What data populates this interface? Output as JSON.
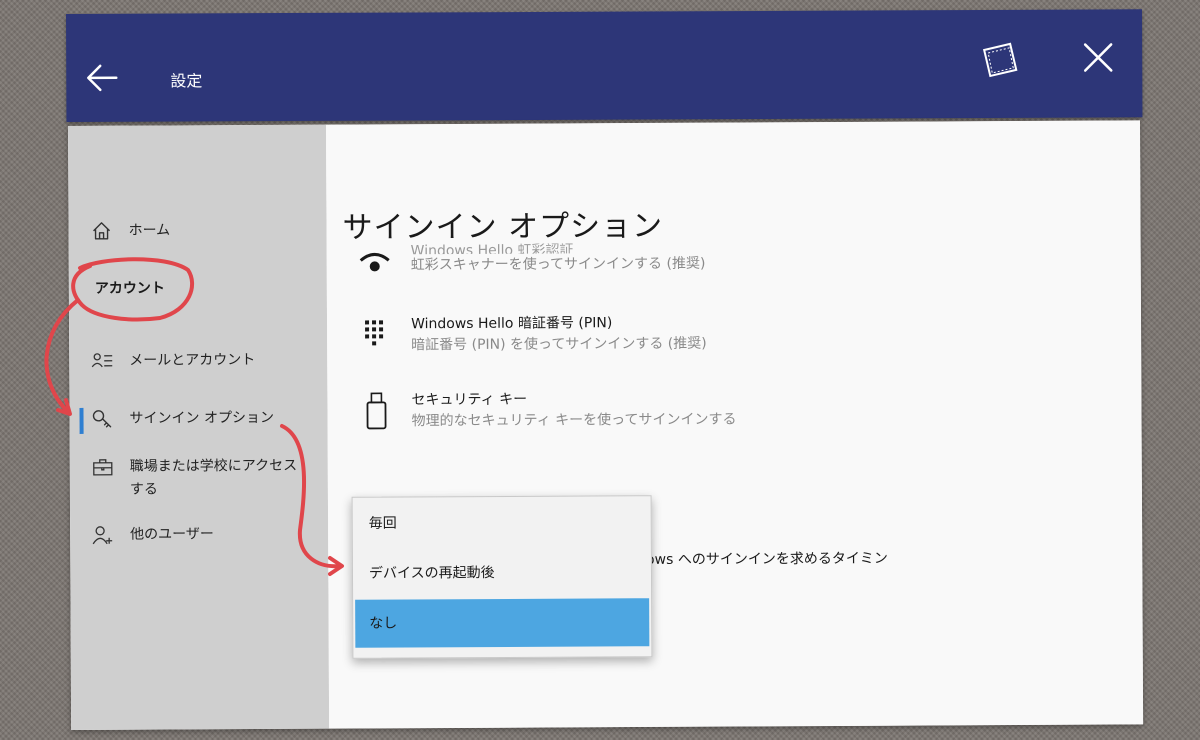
{
  "titlebar": {
    "title": "設定"
  },
  "sidebar": {
    "home_label": "ホーム",
    "section_header": "アカウント",
    "items": [
      {
        "label": "メールとアカウント"
      },
      {
        "label": "サインイン オプション"
      },
      {
        "label": "職場または学校にアクセスする"
      },
      {
        "label": "他のユーザー"
      }
    ]
  },
  "main": {
    "page_title": "サインイン オプション",
    "options": [
      {
        "title": "Windows Hello 虹彩認証",
        "desc": "虹彩スキャナーを使ってサインインする (推奨)",
        "icon": "eye-icon"
      },
      {
        "title": "Windows Hello 暗証番号 (PIN)",
        "desc": "暗証番号 (PIN) を使ってサインインする (推奨)",
        "icon": "keypad-icon"
      },
      {
        "title": "セキュリティ キー",
        "desc": "物理的なセキュリティ キーを使ってサインインする",
        "icon": "usb-key-icon"
      }
    ],
    "signin_required_text": "ndows へのサインインを求めるタイミン"
  },
  "dropdown": {
    "options": [
      "毎回",
      "デバイスの再起動後",
      "なし"
    ],
    "selected_index": 2,
    "selected_color": "#4da6e1"
  },
  "colors": {
    "titlebar_bg": "#2d3678",
    "sidebar_bg": "#cfcfcf",
    "accent": "#2f7fd1",
    "annotation_red": "#e0464b"
  }
}
